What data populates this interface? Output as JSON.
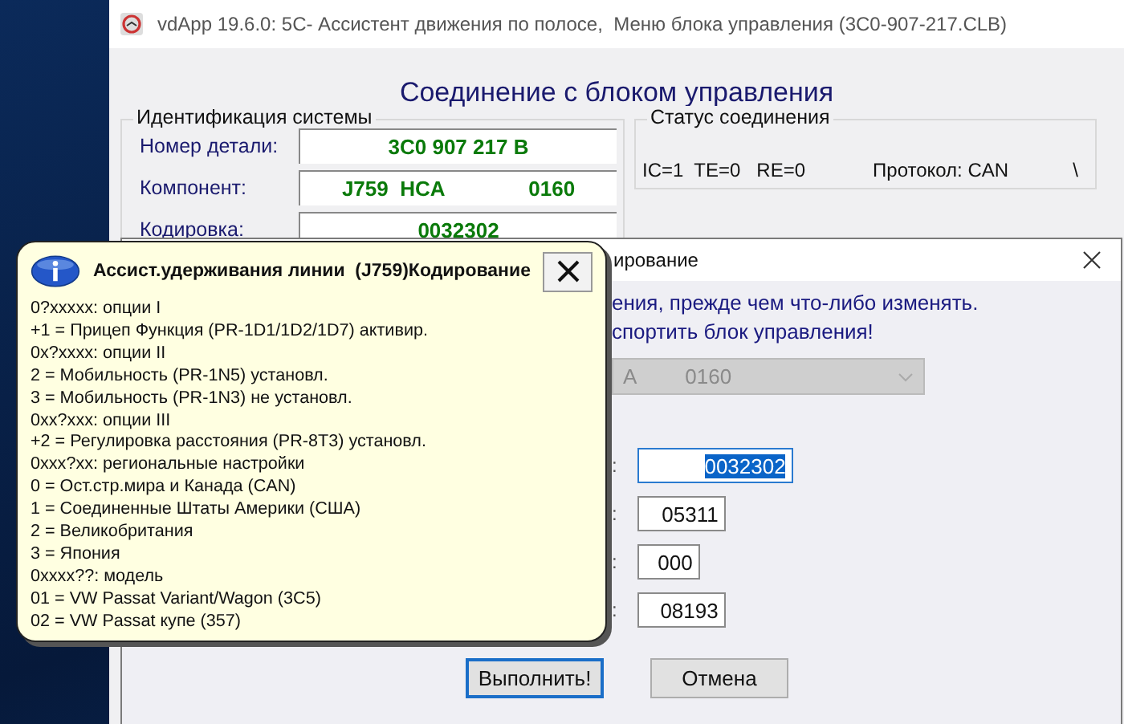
{
  "main_window": {
    "title": "vdApp 19.6.0: 5C- Ассистент движения по полосе,  Меню блока управления (3C0-907-217.CLB)",
    "heading": "Соединение с блоком управления",
    "identification": {
      "title": "Идентификация системы",
      "rows": [
        {
          "label": "Номер детали:",
          "values": [
            "3C0 907 217 B"
          ]
        },
        {
          "label": "Компонент:",
          "values": [
            "J759  HCA",
            "0160"
          ]
        },
        {
          "label": "Кодировка:",
          "values": [
            "0032302"
          ]
        }
      ]
    },
    "status": {
      "title": "Статус соединения",
      "connection": "IC=1  TE=0   RE=0",
      "protocol": "Протокол: CAN",
      "spinner": "\\"
    }
  },
  "dialog": {
    "title": "ирование",
    "lines": [
      "ения, прежде чем что-либо изменять.",
      "спортить блок управления!"
    ],
    "combo": {
      "values": [
        "A",
        "0160"
      ],
      "disabled": true
    },
    "fields": [
      {
        "label": ":",
        "value": "0032302",
        "selected": true
      },
      {
        "label": ":",
        "value": "05311",
        "selected": false
      },
      {
        "label": ":",
        "value": "000",
        "selected": false
      },
      {
        "label": ":",
        "value": "08193",
        "selected": false
      }
    ],
    "buttons": [
      {
        "label": "Выполнить!",
        "focused": true
      },
      {
        "label": "Отмена",
        "focused": false
      }
    ]
  },
  "tooltip": {
    "title": "Ассист.удерживания линии  (J759)Кодирование",
    "lines": [
      "0?xxxxx: опции I",
      "+1 = Прицеп Функция (PR-1D1/1D2/1D7) активир.",
      "0x?xxxx: опции II",
      "2 = Мобильность (PR-1N5) установл.",
      "3 = Мобильность (PR-1N3) не установл.",
      "0xx?xxx: опции III",
      "+2 = Регулировка расстояния (PR-8T3) установл.",
      "0xxx?xx: региональные настройки",
      "0 = Ост.стр.мира и Канада (CAN)",
      "1 = Соединенные Штаты Америки (США)",
      "2 = Великобритания",
      "3 = Япония",
      "0xxxx??: модель",
      "01 = VW Passat Variant/Wagon (3C5)",
      "02 = VW Passat купе (357)"
    ]
  }
}
